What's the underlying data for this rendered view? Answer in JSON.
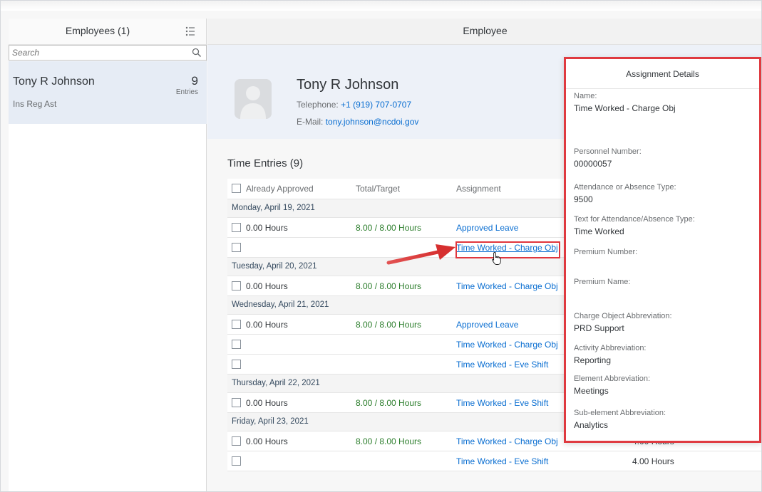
{
  "master": {
    "title": "Employees (1)",
    "search_placeholder": "Search",
    "item": {
      "name": "Tony R Johnson",
      "count": "9",
      "count_label": "Entries",
      "subtitle": "Ins Reg Ast"
    }
  },
  "detail": {
    "title": "Employee",
    "profile": {
      "name": "Tony R Johnson",
      "phone_label": "Telephone:",
      "phone": "+1 (919) 707-0707",
      "email_label": "E-Mail:",
      "email": "tony.johnson@ncdoi.gov"
    },
    "entries_title": "Time Entries (9)",
    "columns": {
      "approved": "Already Approved",
      "total": "Total/Target",
      "assignment": "Assignment"
    },
    "groups": [
      {
        "date": "Monday, April 19, 2021",
        "rows": [
          {
            "hours": "0.00 Hours",
            "total": "8.00 / 8.00 Hours",
            "assignment": "Approved Leave",
            "amount": ""
          },
          {
            "hours": "",
            "total": "",
            "assignment": "Time Worked - Charge Obj",
            "amount": ""
          }
        ]
      },
      {
        "date": "Tuesday, April 20, 2021",
        "rows": [
          {
            "hours": "0.00 Hours",
            "total": "8.00 / 8.00 Hours",
            "assignment": "Time Worked - Charge Obj",
            "amount": ""
          }
        ]
      },
      {
        "date": "Wednesday, April 21, 2021",
        "rows": [
          {
            "hours": "0.00 Hours",
            "total": "8.00 / 8.00 Hours",
            "assignment": "Approved Leave",
            "amount": ""
          },
          {
            "hours": "",
            "total": "",
            "assignment": "Time Worked - Charge Obj",
            "amount": ""
          },
          {
            "hours": "",
            "total": "",
            "assignment": "Time Worked - Eve Shift",
            "amount": ""
          }
        ]
      },
      {
        "date": "Thursday, April 22, 2021",
        "rows": [
          {
            "hours": "0.00 Hours",
            "total": "8.00 / 8.00 Hours",
            "assignment": "Time Worked - Eve Shift",
            "amount": ""
          }
        ]
      },
      {
        "date": "Friday, April 23, 2021",
        "rows": [
          {
            "hours": "0.00 Hours",
            "total": "8.00 / 8.00 Hours",
            "assignment": "Time Worked - Charge Obj",
            "amount": "4.00 Hours"
          },
          {
            "hours": "",
            "total": "",
            "assignment": "Time Worked - Eve Shift",
            "amount": "4.00 Hours"
          }
        ]
      }
    ]
  },
  "popover": {
    "title": "Assignment Details",
    "fields": [
      {
        "label": "Name:",
        "value": "Time Worked - Charge Obj"
      },
      {
        "label": "Personnel Number:",
        "value": "00000057"
      },
      {
        "label": "Attendance or Absence Type:",
        "value": "9500"
      },
      {
        "label": "Text for Attendance/Absence Type:",
        "value": "Time Worked"
      },
      {
        "label": "Premium Number:",
        "value": ""
      },
      {
        "label": "Premium Name:",
        "value": ""
      },
      {
        "label": "Charge Object Abbreviation:",
        "value": "PRD Support"
      },
      {
        "label": "Activity Abbreviation:",
        "value": "Reporting"
      },
      {
        "label": "Element Abbreviation:",
        "value": "Meetings"
      },
      {
        "label": "Sub-element Abbreviation:",
        "value": "Analytics"
      }
    ]
  },
  "colors": {
    "accent_link": "#0a6ed1",
    "status_green": "#2b7d2b",
    "highlight_red": "#e0363d",
    "selection_bg": "#e6ecf5"
  },
  "icons": {
    "filter": "sort-filter-icon",
    "search": "search-icon",
    "avatar": "person-placeholder-icon",
    "cursor": "hand-pointer-icon",
    "arrow": "red-arrow-annotation"
  }
}
